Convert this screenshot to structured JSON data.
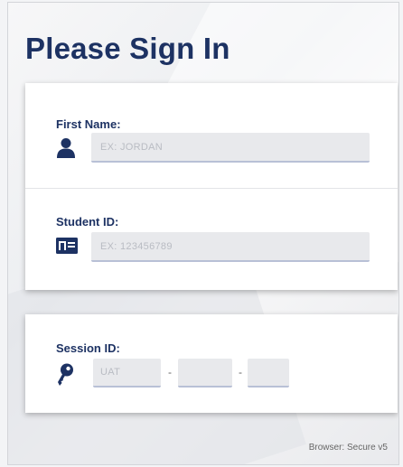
{
  "page": {
    "title": "Please Sign In"
  },
  "identity": {
    "first_name": {
      "label": "First Name:",
      "placeholder": "EX: JORDAN",
      "value": "",
      "icon": "person-icon"
    },
    "student_id": {
      "label": "Student ID:",
      "placeholder": "EX: 123456789",
      "value": "",
      "icon": "id-card-icon"
    }
  },
  "session": {
    "label": "Session ID:",
    "icon": "key-icon",
    "prefix_placeholder": "UAT",
    "separator": "-",
    "part1_value": "",
    "part2_value": ""
  },
  "footer": {
    "text": "Browser: Secure v5"
  },
  "colors": {
    "navy": "#1d3263",
    "input_bg": "#e8e9ec",
    "card_bg": "#ffffff"
  }
}
